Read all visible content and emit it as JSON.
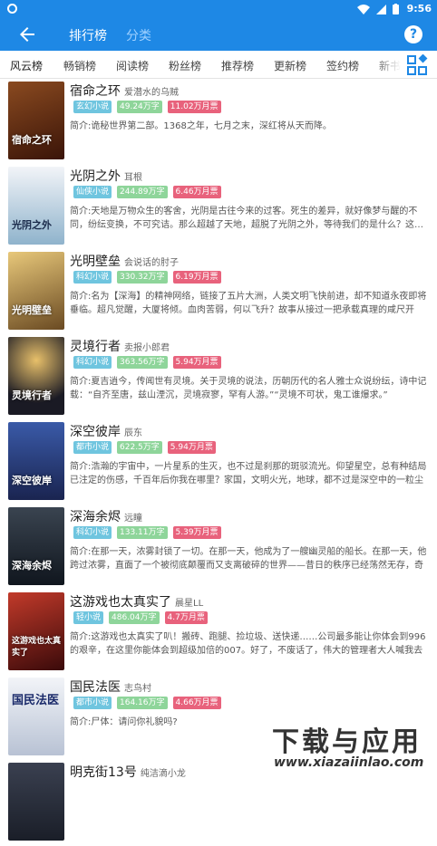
{
  "statusbar": {
    "time": "9:56"
  },
  "appbar": {
    "tab_active": "排行榜",
    "tab_inactive": "分类",
    "help": "?"
  },
  "categories": [
    "风云榜",
    "畅销榜",
    "阅读榜",
    "粉丝榜",
    "推荐榜",
    "更新榜",
    "签约榜",
    "新书"
  ],
  "books": [
    {
      "title": "宿命之环",
      "author": "爱潜水的乌贼",
      "genre": "玄幻小说",
      "words": "49.24万字",
      "votes": "11.02万月票",
      "summary": "简介:诡秘世界第二部。1368之年，七月之末，深红将从天而降。",
      "cover_color": "#5a2a1a",
      "cover_text": "宿命之环"
    },
    {
      "title": "光阴之外",
      "author": "耳根",
      "genre": "仙侠小说",
      "words": "244.89万字",
      "votes": "6.46万月票",
      "summary": "简介:天地是万物众生的客舍，光阴是古往今来的过客。死生的差异，就好像梦与醒的不同，纷纭变换，不可究诘。那么超越了天地，超脱了光阴之外，等待我们的是什么？这…",
      "cover_color": "#8fb3cc",
      "cover_text": "光阴之外"
    },
    {
      "title": "光明壁垒",
      "author": "会说话的肘子",
      "genre": "科幻小说",
      "words": "330.32万字",
      "votes": "6.19万月票",
      "summary": "简介:名为【深海】的精神网络，链接了五片大洲，人类文明飞快前进，却不知道永夜即将垂临。超凡觉醒，大厦将倾。血肉苦弱，何以飞升？故事从接过一把承载真理的咸尺开始。颜…",
      "cover_color": "#b58a4a",
      "cover_text": "光明壁垒"
    },
    {
      "title": "灵境行者",
      "author": "卖报小郎君",
      "genre": "科幻小说",
      "words": "363.56万字",
      "votes": "5.94万月票",
      "summary": "简介:夏吉逍今，传闻世有灵境。关于灵境的说法，历朝历代的名人雅士众说纷纭，诗中记载：“自齐至唐，兹山湮沉，灵境寂寥，罕有人游。”“灵境不可状，鬼工谁爆求。”",
      "cover_color": "#2a2a3a",
      "cover_text": "灵境行者"
    },
    {
      "title": "深空彼岸",
      "author": "辰东",
      "genre": "都市小说",
      "words": "622.5万字",
      "votes": "5.94万月票",
      "summary": "简介:浩瀚的宇宙中，一片星系的生灭，也不过是刹那的斑驳流光。仰望星空，总有种结局已注定的伤感，千百年后你我在哪里？家国，文明火光，地球，都不过是深空中的一粒尘埃。…",
      "cover_color": "#2c3f7a",
      "cover_text": "深空彼岸"
    },
    {
      "title": "深海余烬",
      "author": "远瞳",
      "genre": "科幻小说",
      "words": "133.11万字",
      "votes": "5.39万月票",
      "summary": "简介:在那一天，浓雾封锁了一切。在那一天，他成为了一艘幽灵船的船长。在那一天，他跨过浓雾，直面了一个被彻底颠覆而又支离破碎的世界——昔日的秩序已经荡然无存，奇诡的…",
      "cover_color": "#1a2430",
      "cover_text": "深海余烬"
    },
    {
      "title": "这游戏也太真实了",
      "author": "晨星LL",
      "genre": "轻小说",
      "words": "486.04万字",
      "votes": "4.7万月票",
      "summary": "简介:这游戏也太真实了叭！搬砖、跑腿、捡垃圾、送快递……公司最多能让你体会到996的艰辛，在这里你能体会到超级加倍的007。好了，不废话了，伟大的管理者大人喊我去搬砖了…",
      "cover_color": "#7a1a1a",
      "cover_text": "这游戏也太真实了"
    },
    {
      "title": "国民法医",
      "author": "志鸟村",
      "genre": "都市小说",
      "words": "164.16万字",
      "votes": "4.66万月票",
      "summary": "简介:尸体：请问你礼貌吗?",
      "cover_color": "#dfe4ec",
      "cover_text": "国民法医"
    },
    {
      "title": "明克街13号",
      "author": "纯洁滴小龙",
      "genre": "",
      "words": "",
      "votes": "",
      "summary": "",
      "cover_color": "#2a2f3a",
      "cover_text": ""
    }
  ],
  "watermark": {
    "brand": "下载与应用",
    "url": "www.xiazaiinlao.com"
  }
}
